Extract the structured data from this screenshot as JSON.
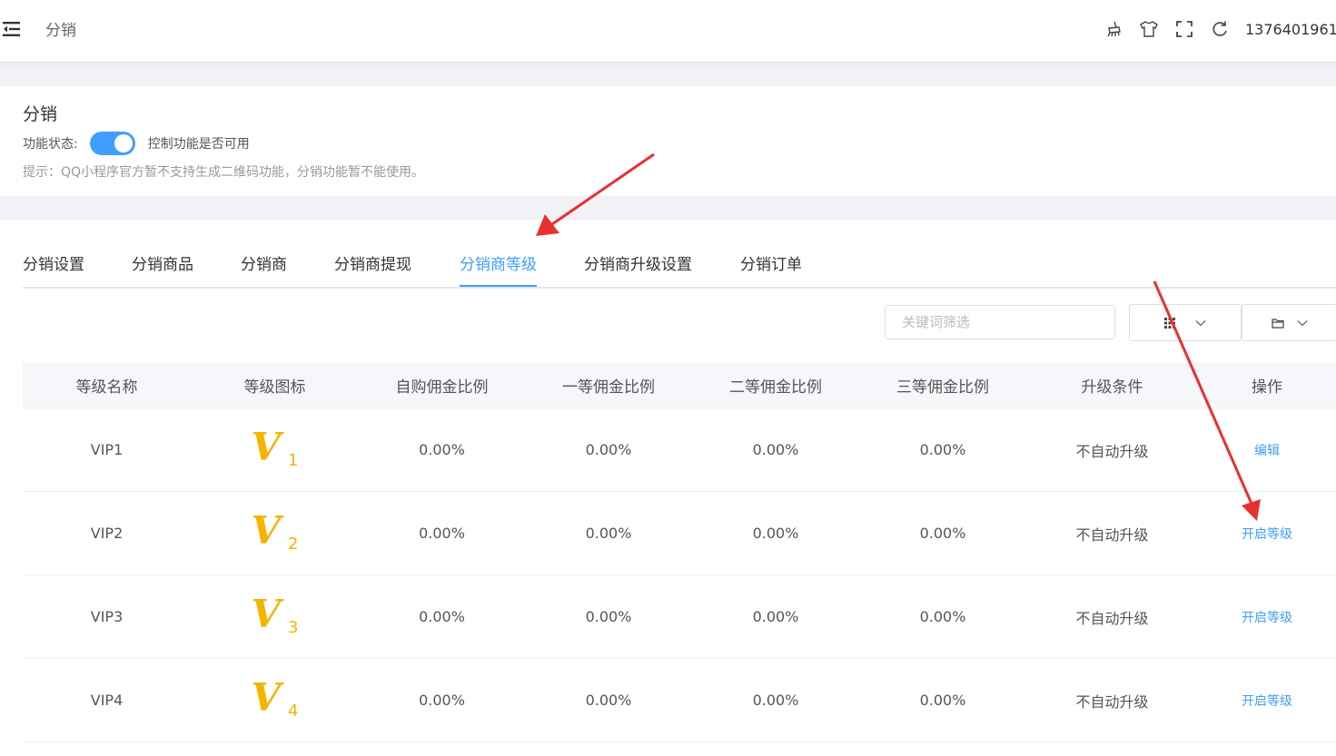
{
  "header": {
    "breadcrumb": "分销",
    "icons": [
      "broom-icon",
      "tshirt-icon",
      "fullscreen-icon",
      "refresh-icon"
    ],
    "user": "1376401961"
  },
  "feature": {
    "title": "分销",
    "status_label": "功能状态:",
    "switch_on": true,
    "switch_desc": "控制功能是否可用",
    "hint": "提示：QQ小程序官方暂不支持生成二维码功能，分销功能暂不能使用。"
  },
  "tabs": [
    {
      "label": "分销设置"
    },
    {
      "label": "分销商品"
    },
    {
      "label": "分销商"
    },
    {
      "label": "分销商提现"
    },
    {
      "label": "分销商等级",
      "active": true
    },
    {
      "label": "分销商升级设置"
    },
    {
      "label": "分销订单"
    }
  ],
  "filter": {
    "search_placeholder": "关键词筛选",
    "column_toggle_icon": "grid-icon",
    "export_icon": "folder-icon"
  },
  "table": {
    "headers": [
      "等级名称",
      "等级图标",
      "自购佣金比例",
      "一等佣金比例",
      "二等佣金比例",
      "三等佣金比例",
      "升级条件",
      "操作"
    ],
    "rows": [
      {
        "name": "VIP1",
        "icon_letter": "V",
        "icon_num": "1",
        "self": "0.00%",
        "first": "0.00%",
        "second": "0.00%",
        "third": "0.00%",
        "condition": "不自动升级",
        "action": "编辑"
      },
      {
        "name": "VIP2",
        "icon_letter": "V",
        "icon_num": "2",
        "self": "0.00%",
        "first": "0.00%",
        "second": "0.00%",
        "third": "0.00%",
        "condition": "不自动升级",
        "action": "开启等级"
      },
      {
        "name": "VIP3",
        "icon_letter": "V",
        "icon_num": "3",
        "self": "0.00%",
        "first": "0.00%",
        "second": "0.00%",
        "third": "0.00%",
        "condition": "不自动升级",
        "action": "开启等级"
      },
      {
        "name": "VIP4",
        "icon_letter": "V",
        "icon_num": "4",
        "self": "0.00%",
        "first": "0.00%",
        "second": "0.00%",
        "third": "0.00%",
        "condition": "不自动升级",
        "action": "开启等级"
      }
    ]
  },
  "colors": {
    "accent": "#409eff",
    "vip_gold": "#f5b400",
    "annotation_arrow": "#e8312f"
  }
}
